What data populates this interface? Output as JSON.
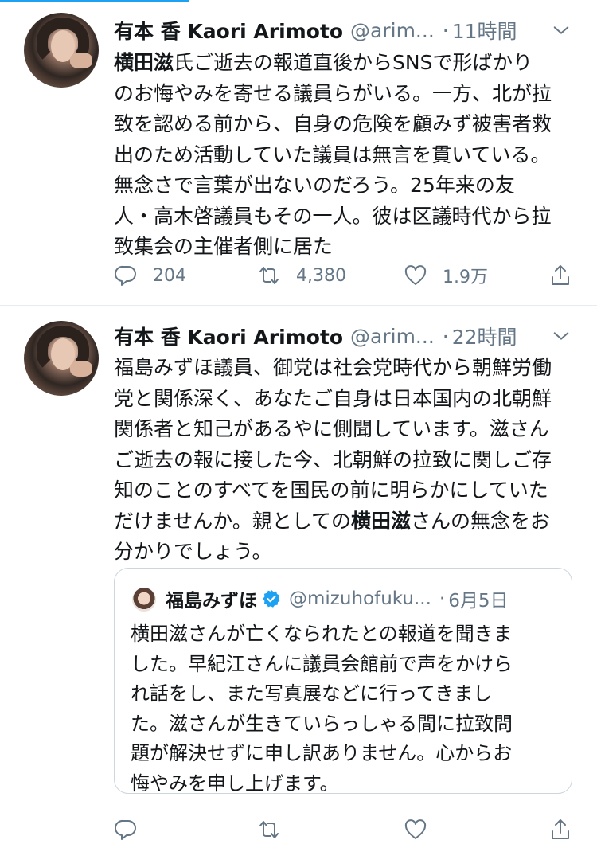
{
  "tweets": [
    {
      "name": "有本 香 Kaori Arimoto",
      "handle": "@arim...",
      "time": "11時間",
      "text_lines": [
        {
          "bold": "横田滋",
          "rest": "氏ご逝去の報道直後からSNSで形ばかり"
        },
        {
          "bold": "",
          "rest": "のお悔やみを寄せる議員らがいる。一方、北が拉"
        },
        {
          "bold": "",
          "rest": "致を認める前から、自身の危険を顧みず被害者救"
        },
        {
          "bold": "",
          "rest": "出のため活動していた議員は無言を貫いている。"
        },
        {
          "bold": "",
          "rest": "無念さで言葉が出ないのだろう。25年来の友"
        },
        {
          "bold": "",
          "rest": "人・高木啓議員もその一人。彼は区議時代から拉"
        },
        {
          "bold": "",
          "rest": "致集会の主催者側に居た"
        }
      ],
      "replies": "204",
      "retweets": "4,380",
      "likes": "1.9万"
    },
    {
      "name": "有本 香 Kaori Arimoto",
      "handle": "@arim...",
      "time": "22時間",
      "text_lines": [
        {
          "pre": "福島みずほ議員、御党は社会党時代から朝鮮労働",
          "bold": "",
          "post": ""
        },
        {
          "pre": "党と関係深く、あなたご自身は日本国内の北朝鮮",
          "bold": "",
          "post": ""
        },
        {
          "pre": "関係者と知己があるやに側聞しています。滋さん",
          "bold": "",
          "post": ""
        },
        {
          "pre": "ご逝去の報に接した今、北朝鮮の拉致に関しご存",
          "bold": "",
          "post": ""
        },
        {
          "pre": "知のことのすべてを国民の前に明らかにしていた",
          "bold": "",
          "post": ""
        },
        {
          "pre": "だけませんか。親としての",
          "bold": "横田滋",
          "post": "さんの無念をお"
        },
        {
          "pre": "分かりでしょう。",
          "bold": "",
          "post": ""
        }
      ],
      "quote": {
        "name": "福島みずほ",
        "handle": "@mizuhofuku...",
        "time": "6月5日",
        "text_lines": [
          "横田滋さんが亡くなられたとの報道を聞きま",
          "した。早紀江さんに議員会館前で声をかけら",
          "れ話をし、また写真展などに行ってきまし",
          "た。滋さんが生きていらっしゃる間に拉致問",
          "題が解決せずに申し訳ありません。心からお",
          "悔やみを申し上げます。"
        ]
      }
    }
  ],
  "colors": {
    "accent": "#1da1f2",
    "text": "#14171a",
    "secondary": "#657786",
    "border": "#e6ecf0"
  },
  "icons": [
    "reply-icon",
    "retweet-icon",
    "like-icon",
    "share-icon",
    "chevron-down-icon",
    "verified-badge-icon"
  ]
}
